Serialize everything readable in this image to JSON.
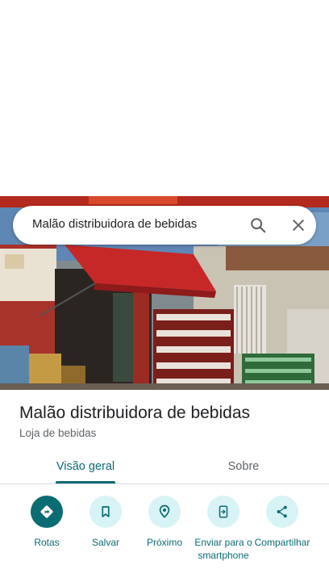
{
  "search": {
    "query": "Malão distribuidora de bebidas",
    "search_icon": "search-icon",
    "close_icon": "close-icon"
  },
  "place": {
    "title": "Malão distribuidora de bebidas",
    "category": "Loja de bebidas"
  },
  "tabs": [
    {
      "label": "Visão geral",
      "selected": true
    },
    {
      "label": "Sobre",
      "selected": false
    }
  ],
  "actions": [
    {
      "label": "Rotas",
      "icon": "directions-icon"
    },
    {
      "label": "Salvar",
      "icon": "bookmark-icon"
    },
    {
      "label": "Próximo",
      "icon": "nearby-icon"
    },
    {
      "label": "Enviar para o smartphone",
      "icon": "send-to-phone-icon"
    },
    {
      "label": "Compartilhar",
      "icon": "share-icon"
    }
  ],
  "colors": {
    "accent": "#0b6b73",
    "action_bg": "#d8f3f6",
    "awning": "#c62828"
  }
}
